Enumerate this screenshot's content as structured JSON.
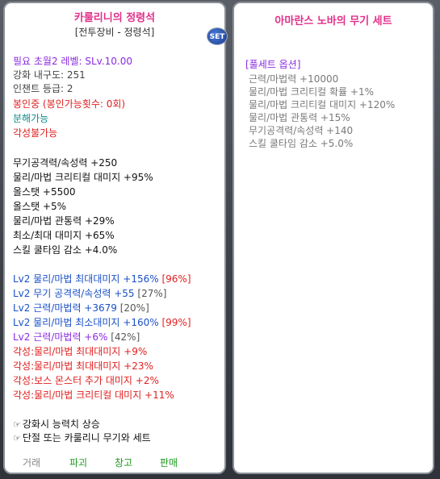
{
  "item": {
    "name": "카룰리니의 정령석",
    "category": "[전투장비 - 정령석]",
    "set_badge": "SET",
    "req_level": "필요 초월2 레벨: SLv.10.00",
    "durability": "강화 내구도: 251",
    "enchant": "인챈트 등급: 2",
    "sealed": "봉인중 (봉인가능횟수: 0회)",
    "dismantle": "분해가능",
    "awaken": "각성불가능",
    "stats": [
      "무기공격력/속성력 +250",
      "물리/마법 크리티컬 대미지 +95%",
      "올스탯 +5500",
      "올스탯 +5%",
      "물리/마법 관통력 +29%",
      "최소/최대 대미지 +65%",
      "스킬 쿨타임 감소 +4.0%"
    ],
    "lv2": [
      {
        "text": "Lv2 물리/마법 최대대미지 +156%",
        "pct": "[96%]"
      },
      {
        "text": "Lv2 무기 공격력/속성력 +55",
        "pct": "[27%]"
      },
      {
        "text": "Lv2 근력/마법력 +3679",
        "pct": "[20%]"
      },
      {
        "text": "Lv2 물리/마법 최소대미지 +160%",
        "pct": "[99%]"
      },
      {
        "text": "Lv2 근력/마법력 +6%",
        "pct": "[42%]"
      }
    ],
    "awaken_stats": [
      "각성:물리/마법 최대대미지 +9%",
      "각성:물리/마법 최대대미지 +23%",
      "각성:보스 몬스터 추가 대미지 +2%",
      "각성:물리/마법 크리티컬 대미지 +11%"
    ],
    "notes": [
      "강화시 능력치 상승",
      "단절 또는 카룰리니 무기와 세트"
    ],
    "note_icon": "pointing-hand-icon",
    "actions": [
      "거래",
      "파괴",
      "창고",
      "판매"
    ]
  },
  "set": {
    "title": "아마란스 노바의 무기 세트",
    "option_header": "[풀세트 옵션]",
    "options": [
      "근력/마법력 +10000",
      "물리/마법 크리티컬 확률 +1%",
      "물리/마법 크리티컬 대미지 +120%",
      "물리/마법 관통력 +15%",
      "무기공격력/속성력 +140",
      "스킬 쿨타임 감소 +5.0%"
    ]
  },
  "colors": {
    "title": "#e0308a",
    "purple": "#8a2be2",
    "red": "#e02020",
    "teal": "#108a8a",
    "blue": "#1a50c8",
    "green": "#1e9a1e",
    "gray": "#7a7a7a"
  }
}
